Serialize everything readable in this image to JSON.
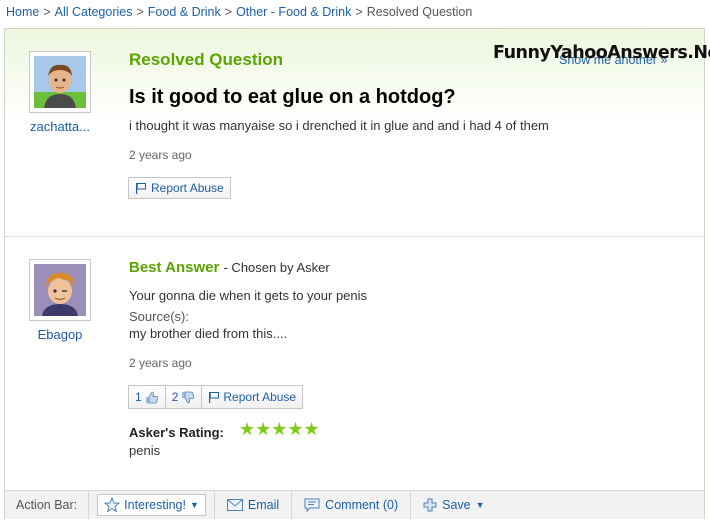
{
  "breadcrumb": {
    "items": [
      "Home",
      "All Categories",
      "Food & Drink",
      "Other - Food & Drink"
    ],
    "current": "Resolved Question",
    "separator": ">"
  },
  "watermark": "FunnyYahooAnswers.Net",
  "question": {
    "status_title": "Resolved Question",
    "show_another": "Show me another »",
    "asker": "zachatta...",
    "title": "Is it good to eat glue on a hotdog?",
    "body": "i thought it was manyaise so i drenched it in glue and and i had 4 of them",
    "time": "2 years ago",
    "report_abuse": "Report Abuse"
  },
  "answer": {
    "label": "Best Answer",
    "chosen_by": "- Chosen by Asker",
    "answerer": "Ebagop",
    "body": "Your gonna die when it gets to your penis",
    "sources_label": "Source(s):",
    "sources": "my brother died from this....",
    "time": "2 years ago",
    "thumbs_up_count": "1",
    "thumbs_down_count": "2",
    "report_abuse": "Report Abuse",
    "asker_rating_label": "Asker's Rating:",
    "stars": "★★★★★",
    "rating_value": 5,
    "asker_comment": "penis"
  },
  "action_bar": {
    "label": "Action Bar:",
    "interesting": "Interesting!",
    "email": "Email",
    "comment": "Comment (0)",
    "save": "Save"
  },
  "colors": {
    "accent_green": "#5aa400",
    "link_blue": "#1f5fa8",
    "star_green": "#7ccc19"
  }
}
